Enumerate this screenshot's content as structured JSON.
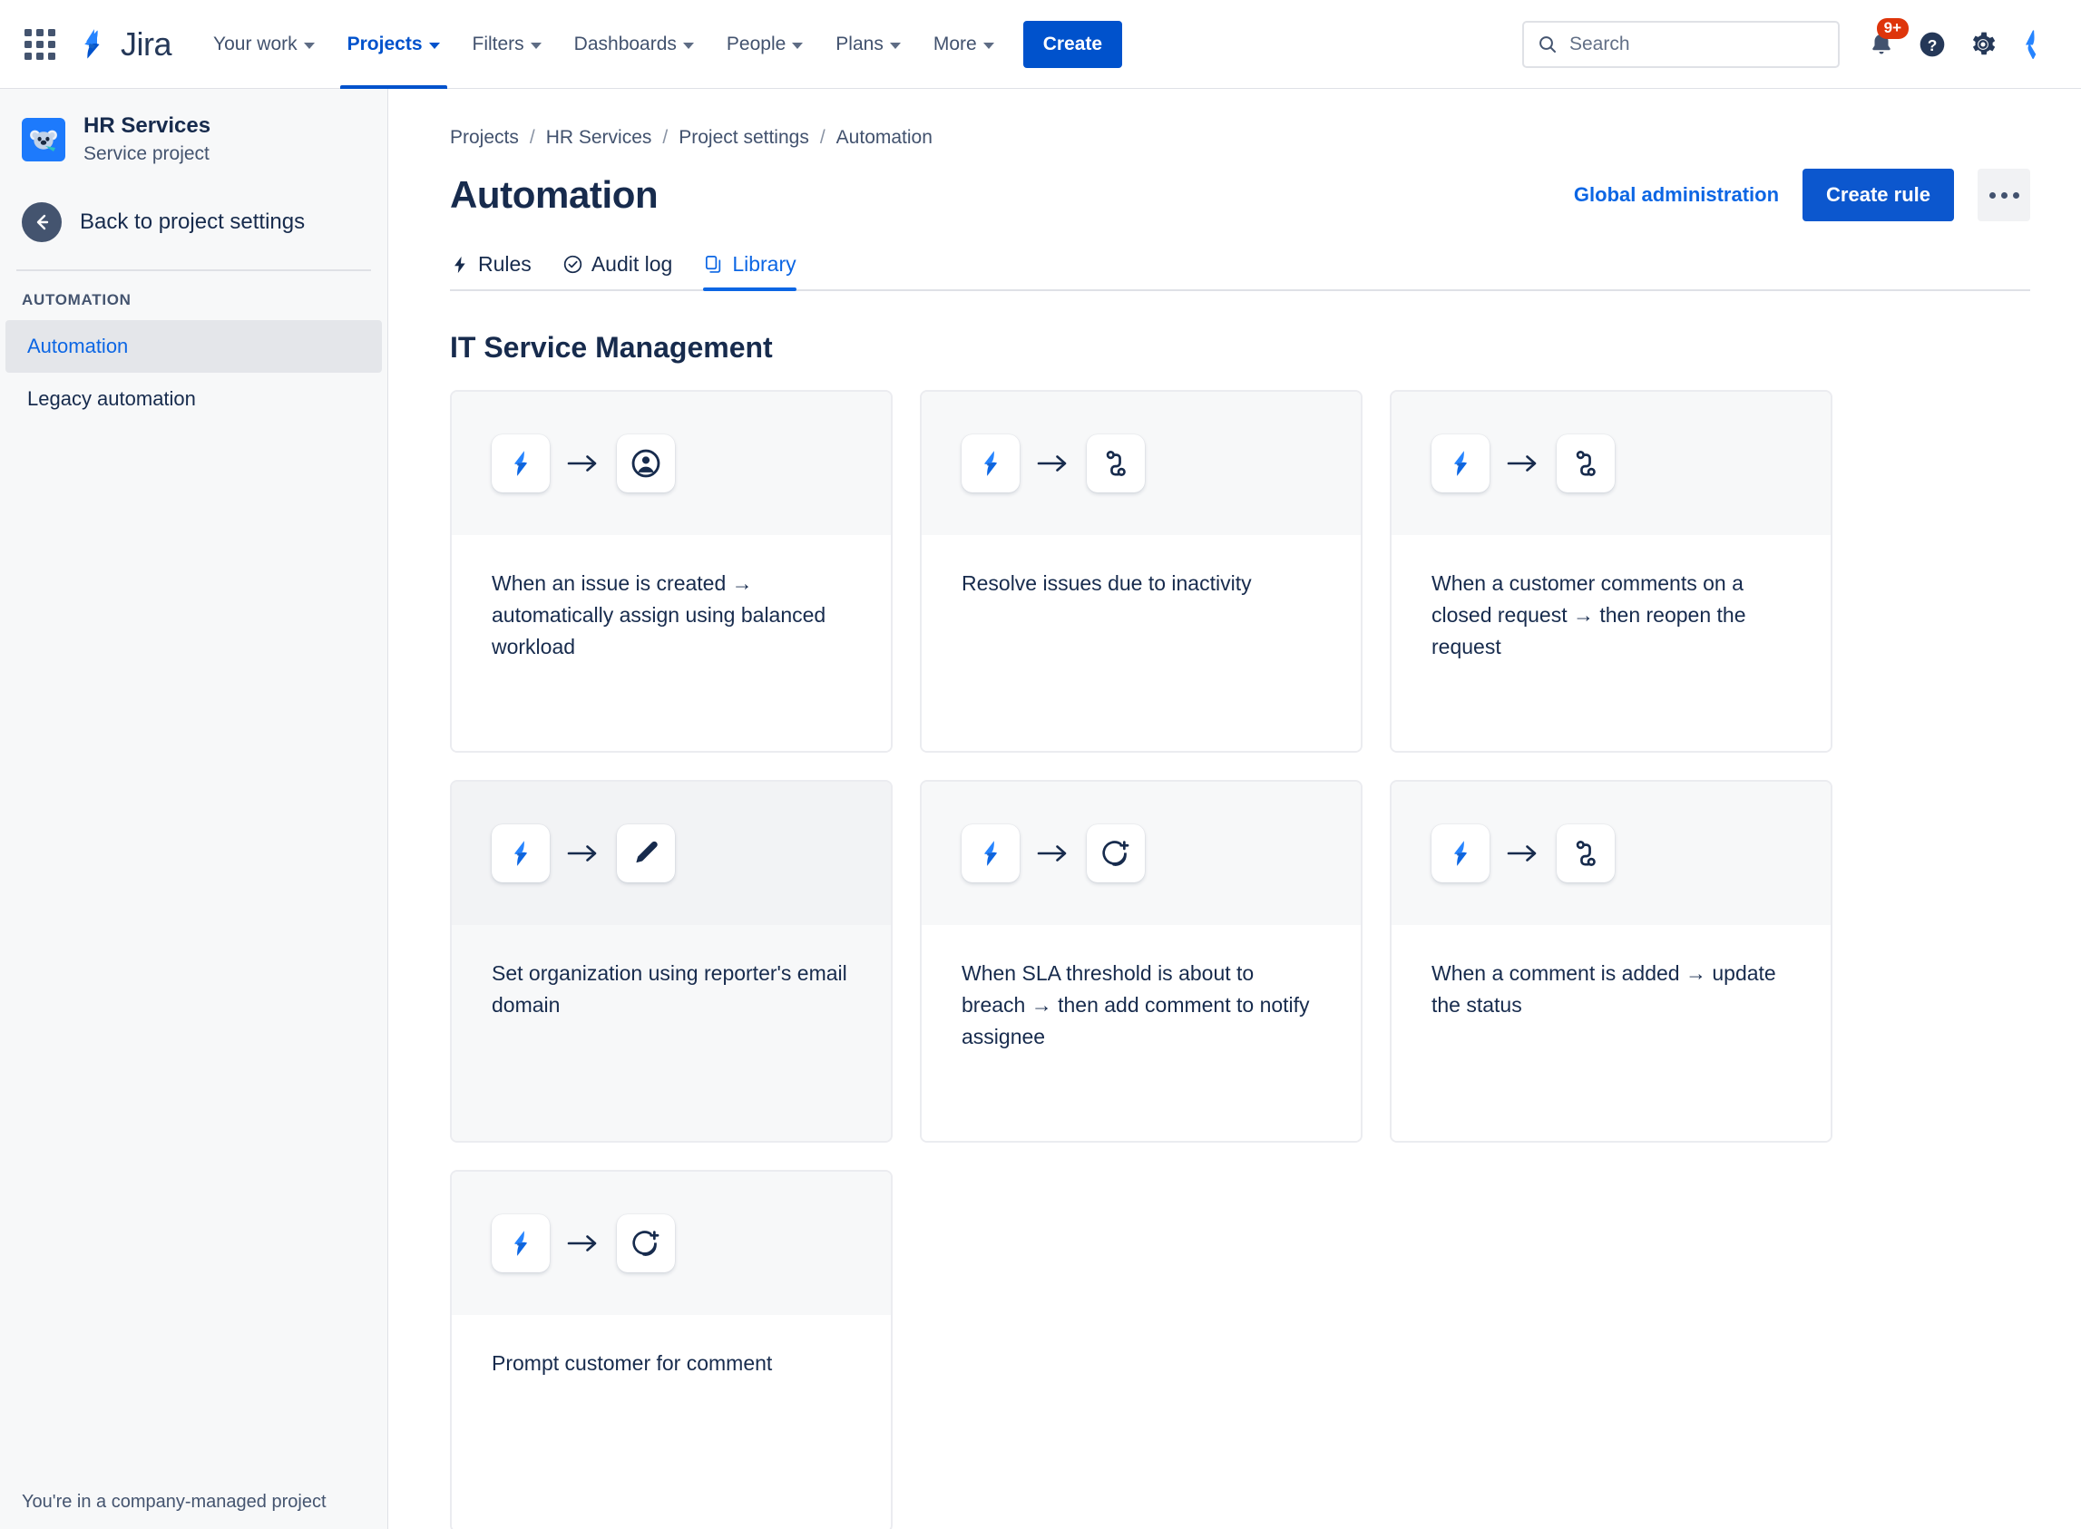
{
  "topnav": {
    "app_switcher_icon": "grid-9-icon",
    "logo_text": "Jira",
    "items": [
      {
        "label": "Your work",
        "has_caret": true,
        "active": false
      },
      {
        "label": "Projects",
        "has_caret": true,
        "active": true
      },
      {
        "label": "Filters",
        "has_caret": true,
        "active": false
      },
      {
        "label": "Dashboards",
        "has_caret": true,
        "active": false
      },
      {
        "label": "People",
        "has_caret": true,
        "active": false
      },
      {
        "label": "Plans",
        "has_caret": true,
        "active": false
      },
      {
        "label": "More",
        "has_caret": true,
        "active": false
      }
    ],
    "create_label": "Create",
    "search": {
      "placeholder": "Search",
      "value": "",
      "icon": "search-icon"
    },
    "notifications": {
      "icon": "bell-icon",
      "badge": "9+"
    },
    "help": {
      "icon": "help-circle-icon"
    },
    "settings": {
      "icon": "gear-icon"
    },
    "account": {
      "icon": "atlassian-logo-icon"
    }
  },
  "sidebar": {
    "project": {
      "name": "HR Services",
      "type": "Service project",
      "avatar_icon": "koala-avatar-icon"
    },
    "back_label": "Back to project settings",
    "back_icon": "arrow-left-icon",
    "section_label": "AUTOMATION",
    "items": [
      {
        "label": "Automation",
        "selected": true
      },
      {
        "label": "Legacy automation",
        "selected": false
      }
    ],
    "footer_text": "You're in a company-managed project"
  },
  "breadcrumb": {
    "items": [
      "Projects",
      "HR Services",
      "Project settings",
      "Automation"
    ],
    "separator": "/"
  },
  "header": {
    "title": "Automation",
    "global_admin_label": "Global administration",
    "create_rule_label": "Create rule",
    "more_icon": "ellipsis-icon"
  },
  "tabs": [
    {
      "label": "Rules",
      "icon": "bolt-icon",
      "active": false
    },
    {
      "label": "Audit log",
      "icon": "check-circle-icon",
      "active": false
    },
    {
      "label": "Library",
      "icon": "copy-icon",
      "active": true
    }
  ],
  "library": {
    "section_title": "IT Service Management",
    "cards": [
      {
        "text": "When an issue is created → automatically assign using balanced workload",
        "trigger_icon": "jira-bolt-icon",
        "arrow_icon": "arrow-right-icon",
        "action_icon": "assignee-person-icon",
        "hovered": false
      },
      {
        "text": "Resolve issues due to inactivity",
        "trigger_icon": "jira-bolt-icon",
        "arrow_icon": "arrow-right-icon",
        "action_icon": "transition-status-icon",
        "hovered": false
      },
      {
        "text": "When a customer comments on a closed request → then reopen the request",
        "trigger_icon": "jira-bolt-icon",
        "arrow_icon": "arrow-right-icon",
        "action_icon": "transition-status-icon",
        "hovered": false
      },
      {
        "text": "Set organization using reporter's email domain",
        "trigger_icon": "jira-bolt-icon",
        "arrow_icon": "arrow-right-icon",
        "action_icon": "edit-pencil-icon",
        "hovered": true
      },
      {
        "text": "When SLA threshold is about to breach → then add comment to notify assignee",
        "trigger_icon": "jira-bolt-icon",
        "arrow_icon": "arrow-right-icon",
        "action_icon": "add-comment-icon",
        "hovered": false
      },
      {
        "text": "When a comment is added → update the status",
        "trigger_icon": "jira-bolt-icon",
        "arrow_icon": "arrow-right-icon",
        "action_icon": "transition-status-icon",
        "hovered": false
      },
      {
        "text": "Prompt customer for comment",
        "trigger_icon": "jira-bolt-icon",
        "arrow_icon": "arrow-right-icon",
        "action_icon": "add-comment-icon",
        "hovered": false
      }
    ]
  },
  "colors": {
    "brand_blue": "#0052CC",
    "link_blue": "#0C66E4",
    "text_dark": "#172B4D",
    "text_muted": "#44546F",
    "badge_red": "#DE350B",
    "surface_grey": "#F7F8F9",
    "border_grey": "#DFE1E6"
  }
}
